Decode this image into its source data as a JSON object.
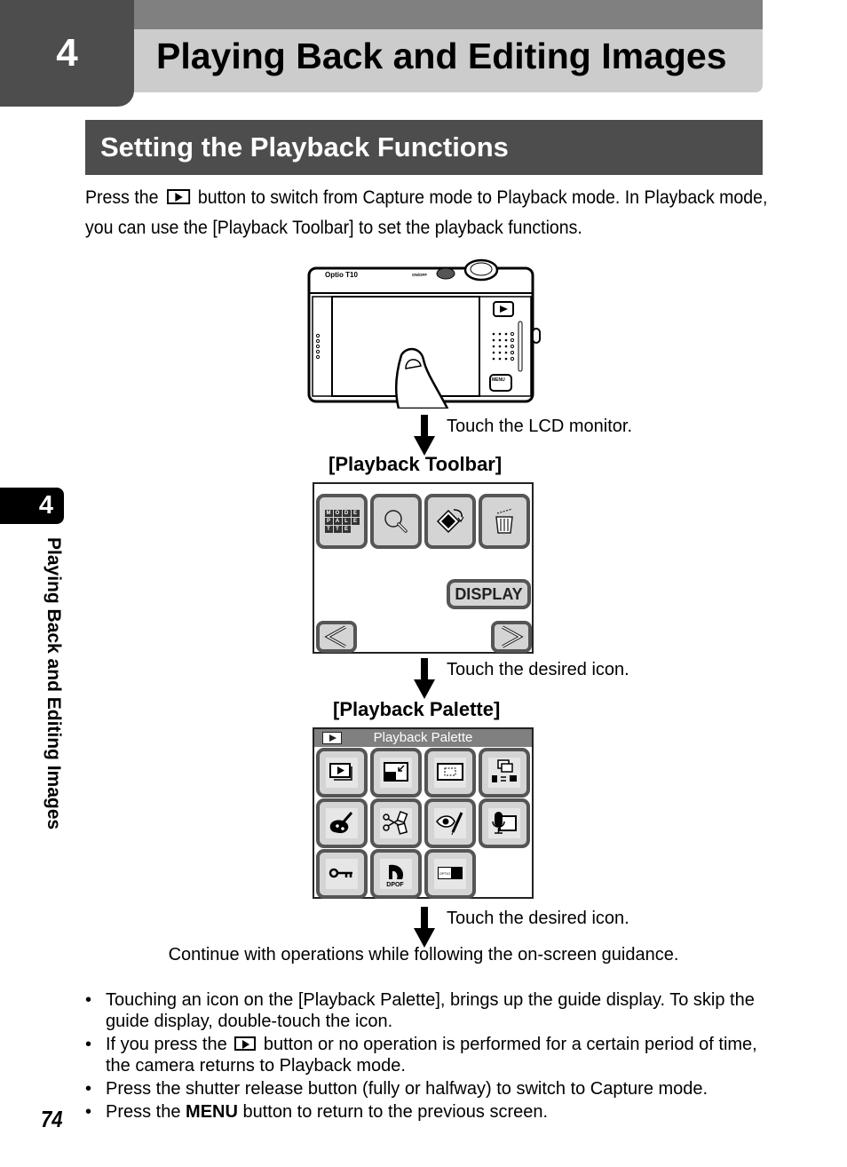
{
  "chapter": {
    "number": "4",
    "title": "Playing Back and Editing Images"
  },
  "section": {
    "title": "Setting the Playback Functions"
  },
  "intro": {
    "before_icon": "Press the",
    "icon": "playback-button-icon",
    "after_icon": "button to switch from Capture mode to Playback mode. In Playback mode, you can use the [Playback Toolbar] to set the playback functions."
  },
  "camera": {
    "model_label": "Optio T10",
    "power_label": "ON/OFF",
    "menu_label": "MENU"
  },
  "steps": [
    {
      "caption": "Touch the LCD monitor."
    },
    {
      "caption": "Touch the desired icon."
    },
    {
      "caption": "Touch the desired icon."
    }
  ],
  "toolbar": {
    "label": "[Playback Toolbar]",
    "icons": [
      {
        "name": "mode-palette-icon",
        "letters": [
          "M",
          "O",
          "D",
          "E",
          "P",
          "A",
          "L",
          "E",
          "T",
          "T",
          "E",
          ""
        ]
      },
      {
        "name": "zoom-magnifier-icon"
      },
      {
        "name": "rotate-icon"
      },
      {
        "name": "delete-trash-icon"
      }
    ],
    "display_button": "DISPLAY",
    "prev_icon": "chevron-left-icon",
    "next_icon": "chevron-right-icon"
  },
  "palette": {
    "label": "[Playback Palette]",
    "header_title": "Playback Palette",
    "icons": [
      "slideshow-icon",
      "resize-icon",
      "cropping-icon",
      "image-copy-icon",
      "digital-filter-icon",
      "frame-composite-icon",
      "red-eye-edit-icon",
      "voice-memo-icon",
      "protect-key-icon",
      "dpof-icon",
      "startup-screen-icon"
    ],
    "dpof_text": "DPOF"
  },
  "continue_text": "Continue with operations while following the on-screen guidance.",
  "notes": [
    {
      "text": "Touching an icon on the [Playback Palette], brings up the guide display. To skip the guide display, double-touch the icon."
    },
    {
      "before": "If you press the",
      "icon": "playback-button-icon",
      "after": "button or no operation is performed for a certain period of time, the camera returns to Playback mode."
    },
    {
      "text": "Press the shutter release button (fully or halfway) to switch to Capture mode."
    },
    {
      "before": "Press the",
      "bold": "MENU",
      "after": "button to return to the previous screen."
    }
  ],
  "side_tab": {
    "number": "4",
    "text": "Playing Back and Editing Images"
  },
  "page_number": "74",
  "bullet": "•"
}
